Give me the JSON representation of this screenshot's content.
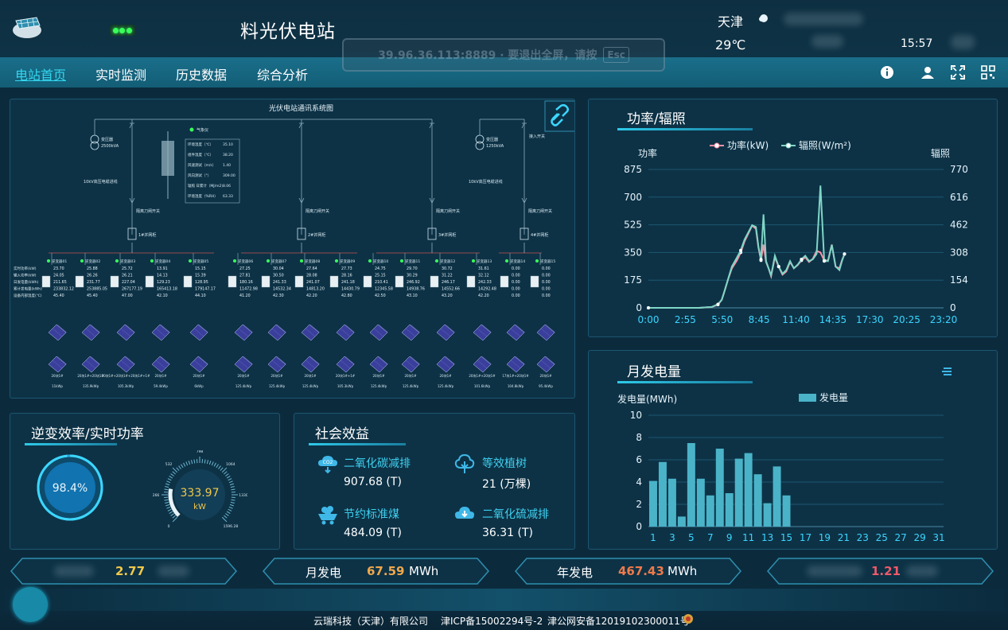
{
  "header": {
    "title": "料光伏电站",
    "city": "天津",
    "temperature": "29℃",
    "time": "15:57",
    "fullscreen_hint": {
      "text": "39.96.36.113:8889 · 要退出全屏，请按",
      "key": "Esc"
    }
  },
  "nav": {
    "items": [
      "电站首页",
      "实时监测",
      "历史数据",
      "综合分析"
    ],
    "active": 0,
    "icons": [
      "info-icon",
      "user-icon",
      "fullscreen-icon",
      "qrcode-icon"
    ]
  },
  "diagram": {
    "title": "光伏电站通讯系统图",
    "weather_station": {
      "label": "气象仪",
      "rows": [
        [
          "环境温度（℃）",
          "35.10"
        ],
        [
          "组件温度（℃）",
          "38.20"
        ],
        [
          "风速测试（m/s）",
          "1.40"
        ],
        [
          "风向测试（°）",
          "309.00"
        ],
        [
          "辐照 日累计（MJ/m2）",
          "8.06"
        ],
        [
          "环境湿度（%RH）",
          "63.33"
        ]
      ]
    },
    "transformers": [
      {
        "label": "变压器",
        "capacity": "2500kVA",
        "note": "10kV高压电缆进线"
      },
      {
        "label": "变压器",
        "capacity": "1250kVA",
        "note": "10kV高压电缆进线"
      }
    ],
    "switch_label": "隔离刀闸开关",
    "access_switch": "接入开关",
    "grid_cabinets": [
      "1#并网柜",
      "2#并网柜",
      "3#并网柜",
      "4#并网柜"
    ],
    "row_labels": [
      "实时功率(kW)",
      "输入功率(kW)",
      "日发电量(kWh)",
      "累计发电量(kWh)",
      "设备内部温度(℃)"
    ],
    "inverters": [
      {
        "name": "逆变器01",
        "v": [
          "23.70",
          "24.05",
          "211.65",
          "233832.12",
          "45.40"
        ]
      },
      {
        "name": "逆变器02",
        "v": [
          "25.88",
          "26.26",
          "231.77",
          "253885.05",
          "45.40"
        ]
      },
      {
        "name": "逆变器03",
        "v": [
          "25.72",
          "26.21",
          "227.04",
          "267177.19",
          "47.00"
        ]
      },
      {
        "name": "逆变器04",
        "v": [
          "13.91",
          "14.13",
          "129.23",
          "165413.18",
          "42.10"
        ]
      },
      {
        "name": "逆变器05",
        "v": [
          "15.15",
          "15.39",
          "128.95",
          "179147.17",
          "44.10"
        ]
      },
      {
        "name": "逆变器06",
        "v": [
          "27.25",
          "27.81",
          "180.16",
          "11472.98",
          "41.20"
        ]
      },
      {
        "name": "逆变器07",
        "v": [
          "30.04",
          "30.50",
          "241.33",
          "14532.34",
          "42.30"
        ]
      },
      {
        "name": "逆变器08",
        "v": [
          "27.64",
          "28.08",
          "241.07",
          "14813.20",
          "42.20"
        ]
      },
      {
        "name": "逆变器09",
        "v": [
          "27.73",
          "28.16",
          "241.18",
          "14430.79",
          "42.80"
        ]
      },
      {
        "name": "逆变器10",
        "v": [
          "24.75",
          "25.15",
          "210.41",
          "12345.58",
          "42.50"
        ]
      },
      {
        "name": "逆变器11",
        "v": [
          "29.70",
          "30.29",
          "246.92",
          "14938.76",
          "43.10"
        ]
      },
      {
        "name": "逆变器12",
        "v": [
          "30.72",
          "31.22",
          "246.17",
          "14552.66",
          "43.20"
        ]
      },
      {
        "name": "逆变器13",
        "v": [
          "31.61",
          "32.12",
          "242.33",
          "14292.48",
          "42.20"
        ]
      },
      {
        "name": "逆变器14",
        "v": [
          "0.00",
          "0.00",
          "0.00",
          "0.00",
          "0.00"
        ]
      },
      {
        "name": "逆变器15",
        "v": [
          "0.00",
          "0.00",
          "0.00",
          "0.00",
          "0.00"
        ]
      }
    ],
    "array_labels": [
      {
        "name": "20块1#",
        "cap": "11kWp"
      },
      {
        "name": "20块1#+20块1#",
        "cap": "135.9kWp"
      },
      {
        "name": "20块1#+20块1#+20块1#+1#",
        "cap": "105.3kWp"
      },
      {
        "name": "20块1#",
        "cap": "59.4kWp"
      },
      {
        "name": "20块1#",
        "cap": "6kWp"
      },
      {
        "name": "20块1#",
        "cap": "125.4kWp"
      },
      {
        "name": "20块1#",
        "cap": "125.4kWp"
      },
      {
        "name": "20块1#",
        "cap": "125.4kWp"
      },
      {
        "name": "20块1#+1#",
        "cap": "105.3kWp"
      },
      {
        "name": "20块1#",
        "cap": "125.4kWp"
      },
      {
        "name": "20块1#",
        "cap": "125.4kWp"
      },
      {
        "name": "20块1#",
        "cap": "125.4kWp"
      },
      {
        "name": "20块1#+20块1#",
        "cap": "101.6kWp"
      },
      {
        "name": "17块1#+20块1#",
        "cap": "104.8kWp"
      },
      {
        "name": "20块1#",
        "cap": "95.4kWp"
      }
    ]
  },
  "efficiency": {
    "title": "逆变效率/实时功率",
    "efficiency": "98.4%",
    "efficiency_value": 0.984,
    "power": "333.97",
    "power_unit": "kW",
    "gauge_ticks": [
      "0",
      "266",
      "532",
      "798",
      "1064",
      "1330",
      "1596.28"
    ],
    "gauge_max": 1596.28
  },
  "social": {
    "title": "社会效益",
    "items": [
      {
        "title": "二氧化碳减排",
        "value": "907.68 (T)",
        "icon": "co2-cloud-icon"
      },
      {
        "title": "等效植树",
        "value": "21 (万棵)",
        "icon": "tree-icon"
      },
      {
        "title": "节约标准煤",
        "value": "484.09 (T)",
        "icon": "coal-cart-icon"
      },
      {
        "title": "二氧化硫减排",
        "value": "36.31 (T)",
        "icon": "so2-cloud-icon"
      }
    ]
  },
  "stats": [
    {
      "label": "",
      "value": "2.77",
      "unit": "",
      "color": "#f1c94a"
    },
    {
      "label": "月发电",
      "value": "67.59",
      "unit": "MWh",
      "color": "#f1a84a"
    },
    {
      "label": "年发电",
      "value": "467.43",
      "unit": "MWh",
      "color": "#f07a4a"
    },
    {
      "label": "",
      "value": "1.21",
      "unit": "",
      "color": "#f05a6a"
    }
  ],
  "footer": {
    "company": "云瑞科技（天津）有限公司",
    "icp": "津ICP备15002294号-2",
    "police": "津公网安备12019102300011号"
  },
  "chart_data": [
    {
      "type": "line",
      "title": "功率/辐照",
      "ylabel": "功率",
      "y2label": "辐照",
      "x_ticks": [
        "0:00",
        "2:55",
        "5:50",
        "8:45",
        "11:40",
        "14:35",
        "17:30",
        "20:25",
        "23:20"
      ],
      "ylim": [
        0,
        875
      ],
      "y_ticks": [
        0,
        175,
        350,
        525,
        700,
        875
      ],
      "y2lim": [
        0,
        770
      ],
      "y2_ticks": [
        0,
        154,
        308,
        462,
        616,
        770
      ],
      "series": [
        {
          "name": "功率(kW)",
          "color": "#ff8fa8",
          "x": [
            0,
            1,
            2,
            3,
            4,
            5,
            5.5,
            5.8,
            6,
            6.3,
            6.6,
            7,
            7.3,
            7.6,
            7.9,
            8.2,
            8.5,
            8.7,
            8.9,
            9.1,
            9.3,
            9.5,
            9.7,
            10,
            10.3,
            10.6,
            10.9,
            11.2,
            11.5,
            11.8,
            12.1,
            12.4,
            12.7,
            13,
            13.3,
            13.6,
            13.9,
            14.2,
            14.5,
            14.8,
            15.1,
            15.3,
            15.5
          ],
          "y": [
            0,
            0,
            0,
            0,
            0,
            5,
            20,
            50,
            100,
            180,
            250,
            300,
            350,
            420,
            470,
            520,
            500,
            380,
            300,
            400,
            290,
            250,
            200,
            320,
            260,
            210,
            230,
            290,
            250,
            270,
            300,
            320,
            290,
            310,
            360,
            350,
            300,
            300,
            400,
            260,
            250,
            300,
            340
          ]
        },
        {
          "name": "辐照(W/m²)",
          "color": "#7fd6c6",
          "x": [
            0,
            1,
            2,
            3,
            4,
            5,
            5.5,
            5.8,
            6,
            6.3,
            6.6,
            7,
            7.3,
            7.6,
            7.9,
            8.2,
            8.5,
            8.7,
            8.9,
            9.1,
            9.3,
            9.5,
            9.7,
            10,
            10.3,
            10.6,
            10.9,
            11.2,
            11.5,
            11.8,
            12.1,
            12.4,
            12.7,
            13,
            13.3,
            13.6,
            13.9,
            14.2,
            14.5,
            14.8,
            15.1,
            15.3,
            15.5
          ],
          "y": [
            0,
            0,
            0,
            0,
            0,
            5,
            20,
            45,
            90,
            160,
            230,
            280,
            320,
            380,
            420,
            460,
            450,
            340,
            270,
            520,
            260,
            220,
            180,
            290,
            230,
            190,
            210,
            260,
            220,
            240,
            270,
            290,
            260,
            270,
            300,
            680,
            260,
            260,
            350,
            230,
            210,
            260,
            300
          ]
        }
      ]
    },
    {
      "type": "bar",
      "title": "月发电量",
      "ylabel": "发电量(MWh)",
      "legend": "发电量",
      "ylim": [
        0,
        10
      ],
      "y_ticks": [
        0,
        2,
        4,
        6,
        8,
        10
      ],
      "x_ticks": [
        "1",
        "3",
        "5",
        "7",
        "9",
        "11",
        "13",
        "15",
        "17",
        "19",
        "21",
        "23",
        "25",
        "27",
        "29",
        "31"
      ],
      "categories": [
        1,
        2,
        3,
        4,
        5,
        6,
        7,
        8,
        9,
        10,
        11,
        12,
        13,
        14,
        15,
        16,
        17,
        18,
        19,
        20,
        21,
        22,
        23,
        24,
        25,
        26,
        27,
        28,
        29,
        30,
        31
      ],
      "values": [
        4.1,
        5.8,
        4.3,
        0.9,
        7.5,
        4.3,
        2.8,
        7.0,
        3.0,
        6.1,
        6.6,
        4.7,
        2.1,
        5.4,
        2.8,
        0,
        0,
        0,
        0,
        0,
        0,
        0,
        0,
        0,
        0,
        0,
        0,
        0,
        0,
        0,
        0
      ],
      "color": "#4ab3c8"
    }
  ]
}
